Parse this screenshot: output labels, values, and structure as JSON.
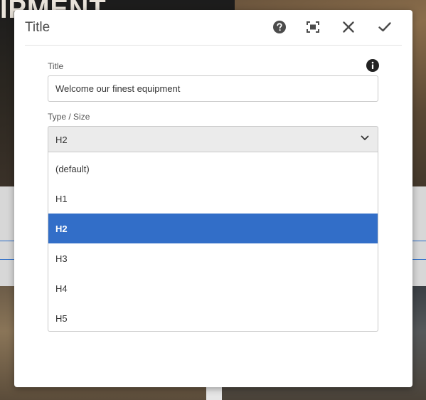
{
  "background": {
    "hero_text": "IPMENT",
    "accent_color": "#2d6ec9"
  },
  "dialog": {
    "title": "Title",
    "header_buttons": {
      "help_icon": "help-icon",
      "fullscreen_icon": "fullscreen-icon",
      "close_icon": "close-icon",
      "done_icon": "checkmark-icon"
    },
    "fields": {
      "title": {
        "label": "Title",
        "value": "Welcome our finest equipment",
        "info_icon": "info-icon"
      },
      "type_size": {
        "label": "Type / Size",
        "selected": "H2",
        "options": [
          "(default)",
          "H1",
          "H2",
          "H3",
          "H4",
          "H5"
        ],
        "selected_index": 2
      }
    },
    "selection_color": "#326ec8"
  }
}
